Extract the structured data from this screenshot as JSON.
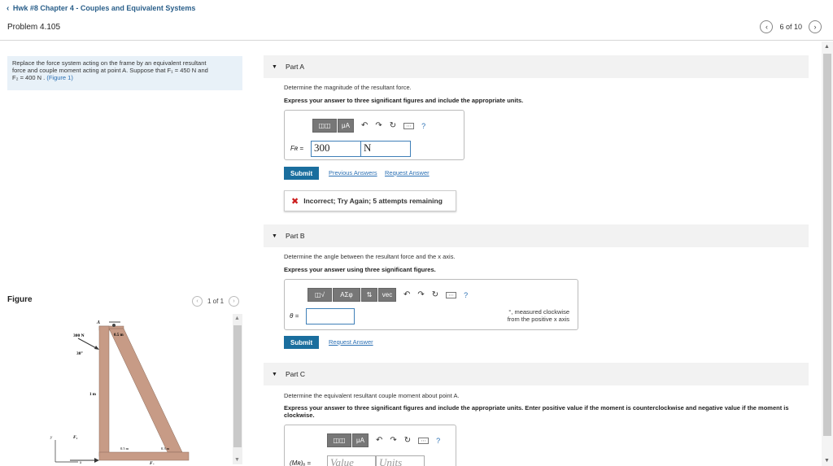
{
  "header": {
    "back_link": "Hwk #8 Chapter 4 - Couples and Equivalent Systems",
    "problem_title": "Problem 4.105",
    "pager_text": "6 of 10"
  },
  "problem": {
    "statement_line1": "Replace the force system acting on the frame by an equivalent resultant",
    "statement_line2": "force and couple moment acting at point A. Suppose that F₁ = 450 N and",
    "statement_line3": "F₂ = 400 N .",
    "figure_link": "(Figure 1)"
  },
  "figure": {
    "label": "Figure",
    "pager_text": "1 of 1",
    "labels": {
      "force_300": "300 N",
      "angle": "30°",
      "point_a": "A",
      "dim_top": "0.5 m",
      "dim_1m": "1 m",
      "f1": "F₁",
      "f2": "F₂",
      "dim_left": "0.5 m",
      "dim_right": "0.3 m",
      "axis_y": "y",
      "axis_x": "x"
    }
  },
  "part_a": {
    "title": "Part A",
    "question": "Determine the magnitude of the resultant force.",
    "instruction": "Express your answer to three significant figures and include the appropriate units.",
    "toolbar_mu": "μA",
    "help": "?",
    "var_label": "Fʀ =",
    "value": "300",
    "units": "N",
    "submit": "Submit",
    "prev_answers": "Previous Answers",
    "request_answer": "Request Answer",
    "feedback": "Incorrect; Try Again; 5 attempts remaining"
  },
  "part_b": {
    "title": "Part B",
    "question": "Determine the angle between the resultant force and the x axis.",
    "instruction": "Express your answer using three significant figures.",
    "tool_greek": "AΣφ",
    "tool_vec": "vec",
    "help": "?",
    "var_label": "θ =",
    "value": "",
    "note_line1": "°, measured clockwise",
    "note_line2": "from the positive x axis",
    "submit": "Submit",
    "request_answer": "Request Answer"
  },
  "part_c": {
    "title": "Part C",
    "question": "Determine the equivalent resultant couple moment about point A.",
    "instruction": "Express your answer to three significant figures and include the appropriate units. Enter positive value if the moment is counterclockwise and negative value if the moment is clockwise.",
    "toolbar_mu": "μA",
    "help": "?",
    "var_label": "(Mʀ)ₐ =",
    "value_placeholder": "Value",
    "units_placeholder": "Units"
  },
  "colors": {
    "accent": "#1a6e9e",
    "link": "#2a6fb3",
    "error": "#cc1f1f",
    "frame": "#c79b86"
  }
}
